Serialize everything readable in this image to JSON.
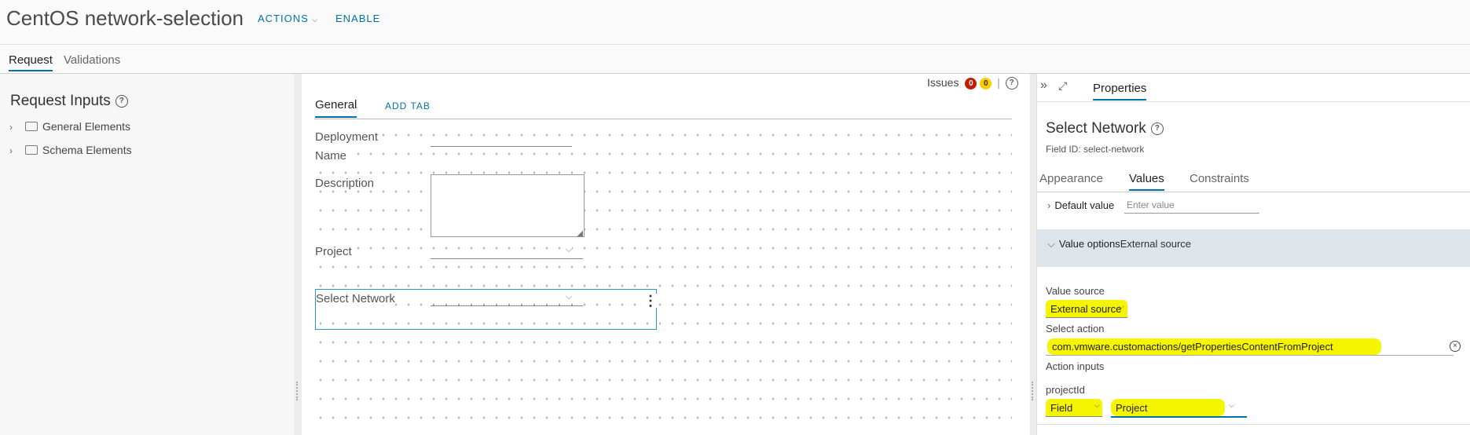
{
  "header": {
    "title": "CentOS network-selection",
    "actions_label": "ACTIONS",
    "enable_label": "ENABLE"
  },
  "top_tabs": {
    "request": "Request",
    "validations": "Validations"
  },
  "left_panel": {
    "title": "Request Inputs",
    "tree": [
      {
        "label": "General Elements"
      },
      {
        "label": "Schema Elements"
      }
    ]
  },
  "canvas": {
    "issues_label": "Issues",
    "issues_errors": "0",
    "issues_warnings": "0",
    "tab_general": "General",
    "add_tab": "ADD TAB",
    "fields": {
      "deployment_name_line1": "Deployment",
      "deployment_name_line2": "Name",
      "description": "Description",
      "project": "Project",
      "select_network": "Select Network"
    }
  },
  "properties": {
    "tab_label": "Properties",
    "field_title": "Select Network",
    "field_id": "Field ID: select-network",
    "tabs": {
      "appearance": "Appearance",
      "values": "Values",
      "constraints": "Constraints"
    },
    "default_value_label": "Default value",
    "default_value_placeholder": "Enter value",
    "value_options_label": "Value options",
    "value_options_value": "External source",
    "value_source_label": "Value source",
    "value_source_value": "External source",
    "select_action_label": "Select action",
    "select_action_value": "com.vmware.customactions/getPropertiesContentFromProject",
    "action_inputs_label": "Action inputs",
    "project_id_label": "projectId",
    "field_type_value": "Field",
    "field_value": "Project"
  },
  "colors": {
    "accent": "#0072a3",
    "highlight": "#f5f500",
    "error_badge": "#c21d00",
    "warning_badge": "#ffcc00"
  }
}
